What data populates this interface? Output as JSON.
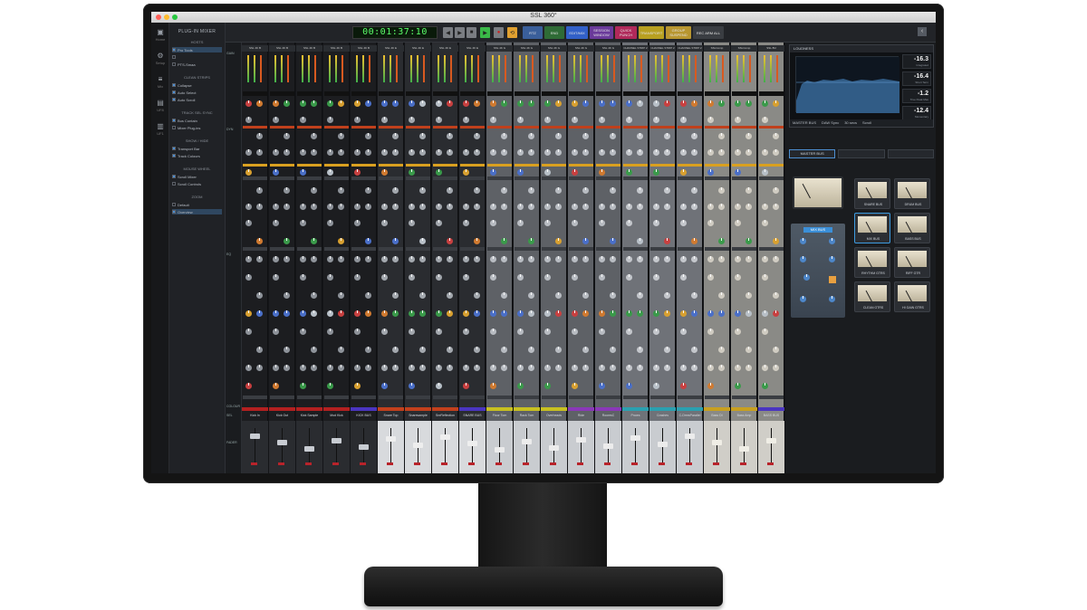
{
  "window": {
    "title": "SSL 360°"
  },
  "colors": {
    "accent": "#4a8fd4",
    "timecode": "#5cff6a",
    "rtz": "#3a5f9a",
    "end": "#2f6b36",
    "edit_mix": "#3260c8",
    "session_window": "#6a3a9a",
    "quick_punch": "#b0295a",
    "transport": "#b8a020",
    "group_suspend": "#b89630",
    "rec_arm_all": "#3a3d42"
  },
  "nav": [
    {
      "icon": "home-icon",
      "label": "Home"
    },
    {
      "icon": "settings-icon",
      "label": "Setup"
    },
    {
      "icon": "mix-icon",
      "label": "Mix"
    },
    {
      "icon": "uf8-icon",
      "label": "UF8"
    },
    {
      "icon": "uf1-icon",
      "label": "UF1"
    }
  ],
  "panel": {
    "title": "PLUG-IN MIXER",
    "sections": [
      {
        "heading": "HOSTS",
        "options": [
          {
            "label": "Pro Tools",
            "checked": true,
            "highlight": true
          },
          {
            "label": "",
            "checked": false
          },
          {
            "label": "PTS-Smaa",
            "checked": false
          }
        ]
      },
      {
        "heading": "CLEAN STRIPS",
        "options": [
          {
            "label": "Collapse",
            "checked": true
          },
          {
            "label": "Auto Select",
            "checked": true
          },
          {
            "label": "Auto Scroll",
            "checked": true
          }
        ]
      },
      {
        "heading": "TRACK SEL SYNC",
        "options": [
          {
            "label": "Bus Contain",
            "checked": true
          },
          {
            "label": "Mixer Plug-ins",
            "checked": false
          }
        ]
      },
      {
        "heading": "SHOW / HIDE",
        "options": [
          {
            "label": "Transport Bar",
            "checked": true
          },
          {
            "label": "Track Colours",
            "checked": true
          }
        ]
      },
      {
        "heading": "MOUSE WHEEL",
        "options": [
          {
            "label": "Scroll Mixer",
            "checked": true
          },
          {
            "label": "Scroll Controls",
            "checked": false
          }
        ]
      },
      {
        "heading": "ZOOM",
        "options": [
          {
            "label": "Default",
            "checked": false
          },
          {
            "label": "Overview",
            "checked": true,
            "highlight": true
          }
        ]
      }
    ]
  },
  "transport": {
    "timecode": "00:01:37:10",
    "buttons": [
      {
        "label": "RTZ",
        "color_key": "rtz"
      },
      {
        "label": "END",
        "color_key": "end"
      },
      {
        "label": "EDIT/MIX",
        "color_key": "edit_mix"
      },
      {
        "label": "SESSION WINDOW",
        "color_key": "session_window"
      },
      {
        "label": "QUICK PUNCH",
        "color_key": "quick_punch"
      },
      {
        "label": "TRANSPORT",
        "color_key": "transport"
      },
      {
        "label": "GROUP SUSPEND",
        "color_key": "group_suspend"
      },
      {
        "label": "REC ARM ALL",
        "color_key": "rec_arm_all"
      }
    ]
  },
  "row_labels": [
    "GAIN",
    "",
    "DYN",
    "",
    "",
    "",
    "EQ",
    "",
    "",
    "",
    "",
    "COLOUR",
    "SEL",
    "",
    "FADER"
  ],
  "strips": [
    {
      "header": "SSL 4K B",
      "name": "Kick In",
      "color": "#b32020",
      "theme": "dark"
    },
    {
      "header": "SSL 4K B",
      "name": "Kick Out",
      "color": "#b32020",
      "theme": "dark"
    },
    {
      "header": "SSL 4K B",
      "name": "Kick Sample",
      "color": "#b32020",
      "theme": "dark"
    },
    {
      "header": "SSL 4K B",
      "name": "Mod Kick",
      "color": "#b32020",
      "theme": "dark"
    },
    {
      "header": "SSL 4K B",
      "name": "KICK BUS",
      "color": "#4a35c0",
      "theme": "dark"
    },
    {
      "header": "SSL 4K E",
      "name": "Snare Top",
      "color": "#c2401c",
      "theme": "darkgrey"
    },
    {
      "header": "SSL 4K E",
      "name": "Snaresample",
      "color": "#c2401c",
      "theme": "darkgrey"
    },
    {
      "header": "SSL 4K E",
      "name": "SnrReflection",
      "color": "#c2401c",
      "theme": "darkgrey"
    },
    {
      "header": "SSL 4K E",
      "name": "SNARE BUS",
      "color": "#4a35c0",
      "theme": "darkgrey"
    },
    {
      "header": "SSL 4K G",
      "name": "Floor Tom",
      "color": "#c8c020",
      "theme": "grey"
    },
    {
      "header": "SSL 4K G",
      "name": "Rack Tom",
      "color": "#c8c020",
      "theme": "grey"
    },
    {
      "header": "SSL 4K G",
      "name": "Overheads",
      "color": "#c8c020",
      "theme": "grey"
    },
    {
      "header": "SSL 4K G",
      "name": "Ride",
      "color": "#8a38b8",
      "theme": "grey"
    },
    {
      "header": "SSL 4K G",
      "name": "RoomsC",
      "color": "#8a38b8",
      "theme": "grey"
    },
    {
      "header": "CHANNEL STRIP 2",
      "name": "Pnoes",
      "color": "#2aa0b0",
      "theme": "lightgrey"
    },
    {
      "header": "CHANNEL STRIP 2",
      "name": "Crashes",
      "color": "#2aa0b0",
      "theme": "lightgrey"
    },
    {
      "header": "CHANNEL STRIP 2",
      "name": "C-DrmsParallel",
      "color": "#2aa0b0",
      "theme": "lightgrey"
    },
    {
      "header": "SSLComp",
      "name": "Bass DI",
      "color": "#c8a020",
      "theme": "cream"
    },
    {
      "header": "SSLComp",
      "name": "Bass Amp",
      "color": "#c8a020",
      "theme": "cream"
    },
    {
      "header": "SSL BU",
      "name": "BASS BUS",
      "color": "#4a35c0",
      "theme": "cream"
    }
  ],
  "loudness": {
    "title": "LOUDNESS",
    "values": [
      {
        "value": "-16.3",
        "unit": "LUFS",
        "label": "Integrated"
      },
      {
        "value": "-16.4",
        "unit": "LUFS",
        "label": "Short Term"
      },
      {
        "value": "-1.2",
        "unit": "dBTP",
        "label": "True Peak Max"
      },
      {
        "value": "-12.4",
        "unit": "LUFS",
        "label": "Momentary"
      }
    ],
    "footer": [
      "MASTER BUS",
      "DAW Sync",
      "30 secs",
      "Scroll"
    ]
  },
  "right_tabs": [
    "MASTER BUS",
    "",
    ""
  ],
  "bus_comp": {
    "label": "MIX BUS"
  },
  "bus_chips": [
    {
      "label": "SNARE BUS",
      "selected": false
    },
    {
      "label": "DRUM BUS",
      "selected": false
    },
    {
      "label": "MIX BUS",
      "selected": true
    },
    {
      "label": "BASS BUS",
      "selected": false
    },
    {
      "label": "RHYTHM GTRS",
      "selected": false
    },
    {
      "label": "RIFF GTR",
      "selected": false
    },
    {
      "label": "CLEAN GTRS",
      "selected": false
    },
    {
      "label": "HI GAIN GTRS",
      "selected": false
    }
  ]
}
